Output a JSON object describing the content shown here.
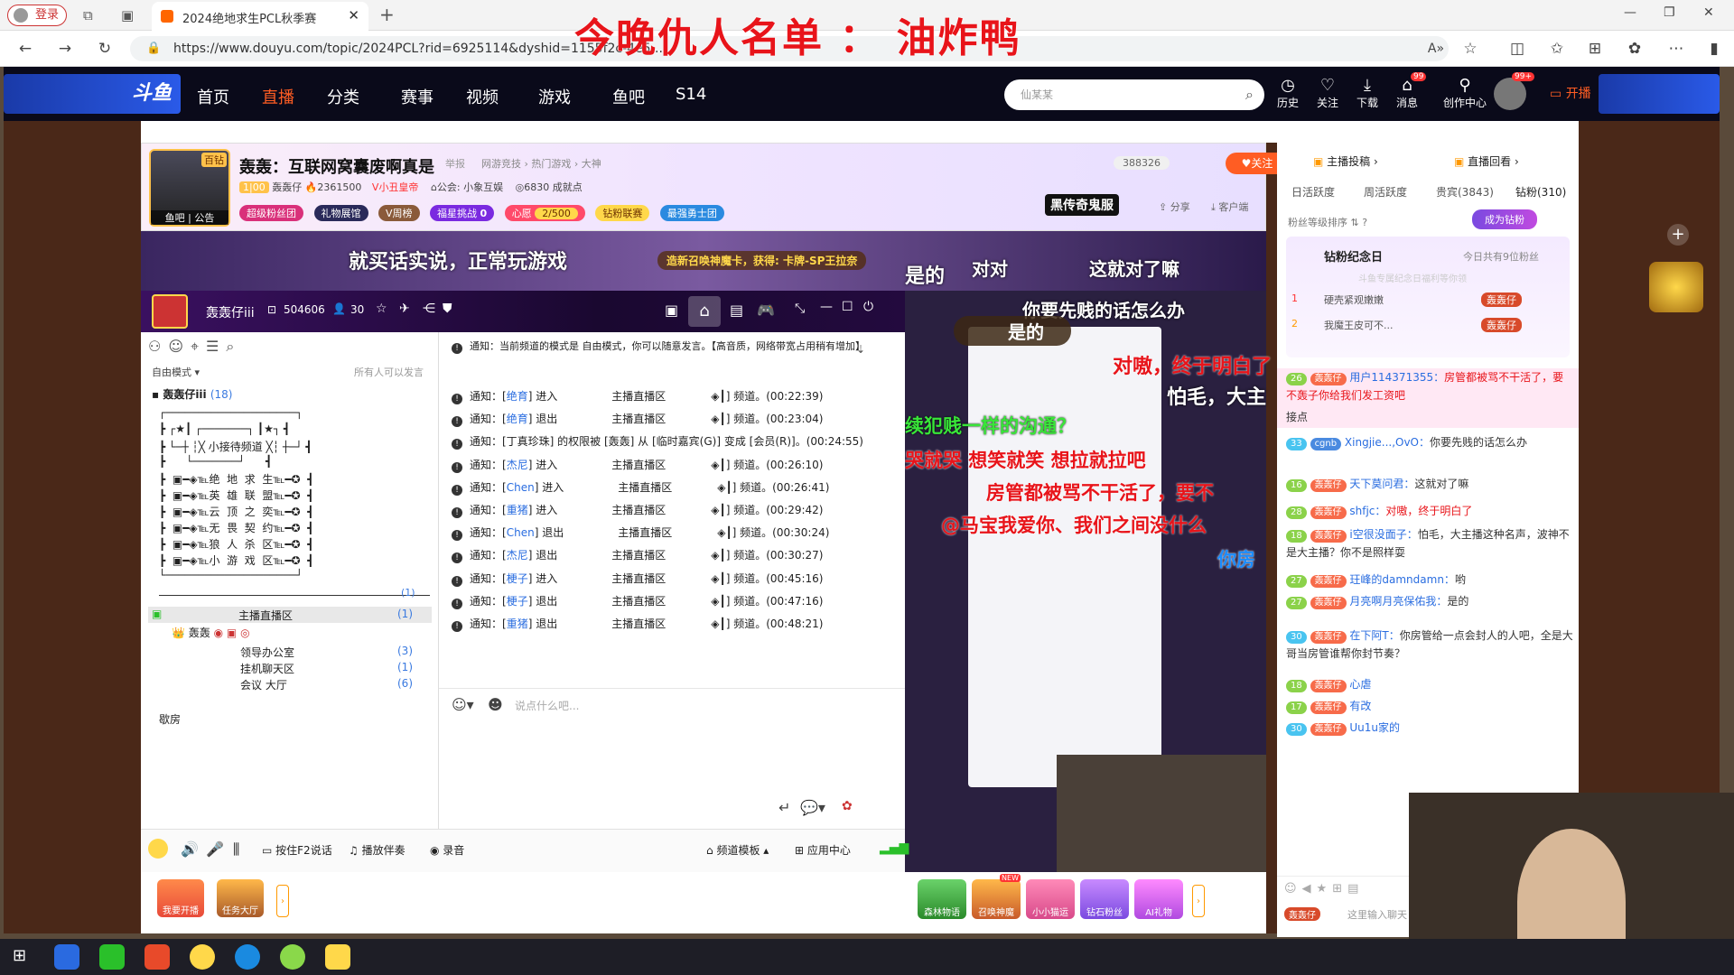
{
  "browser": {
    "login": "登录",
    "tab_title": "2024绝地求生PCL秋季赛",
    "url": "https://www.douyu.com/topic/2024PCL?rid=6925114&dyshid=1155f2c-4e5...",
    "overlay_title": "今晚仇人名单 ： 油炸鸭"
  },
  "nav": {
    "items": [
      "首页",
      "直播",
      "分类",
      "赛事",
      "视频",
      "游戏",
      "鱼吧",
      "S14"
    ],
    "search_placeholder": "仙某某",
    "icons": [
      {
        "label": "历史",
        "icon": "history-icon"
      },
      {
        "label": "关注",
        "icon": "heart-icon"
      },
      {
        "label": "下载",
        "icon": "download-icon"
      },
      {
        "label": "消息",
        "icon": "bell-icon"
      },
      {
        "label": "创作中心",
        "icon": "pin-icon"
      }
    ],
    "msg_badge": "99",
    "avatar_badge": "99+",
    "live_btn": "开播"
  },
  "room": {
    "title": "轰轰：互联网窝囊废啊真是",
    "report": "举报",
    "category": "网游竞技 › 热门游戏 › 大神",
    "streamer": "轰轰仔",
    "fans": "2361500",
    "tag": "小丑皇帝",
    "guild": "公会: 小象互娱",
    "achievements": "6830 成就点",
    "count": "388326",
    "follow": "关注",
    "share": "分享",
    "client": "客户端",
    "tags": [
      "超级粉丝团",
      "礼物展馆",
      "V周榜",
      "福星挑战",
      "心愿",
      "2/500",
      "钻粉联赛",
      "最强勇士团"
    ],
    "fuxing_val": "0",
    "avatar_caption": "鱼吧 | 公告",
    "badge": "百钻",
    "heichuan": "黑传奇鬼服"
  },
  "danmu_top": [
    "就买话实说，正常玩游戏",
    "造新召唤神魔卡，获得: 卡牌-SP王拉奈",
    "是的",
    "对对",
    "这就对了嘛"
  ],
  "yy": {
    "channel_name": "轰轰仔iii",
    "channel_id": "504606",
    "online": "30",
    "mode": "自由模式",
    "mode_right": "所有人可以发言",
    "tree_root": "轰轰仔iii",
    "tree_root_count": "(18)",
    "tree": [
      "┌────────────────────┐",
      "┣ ┌★┃ ┌───────┐ ┃★┐ ┫",
      "┣ └─┼ ┆╳ 小接待频道 ╳┆ ┼─┘ ┫",
      "┣      └───────┘      ┫",
      "┣  ▣━◈℡绝  地  求  生℡━✪  ┫",
      "┣  ▣━◈℡英  雄  联  盟℡━✪  ┫",
      "┣  ▣━◈℡云  顶  之  奕℡━✪  ┫",
      "┣  ▣━◈℡无  畏  契  约℡━✪  ┫",
      "┣  ▣━◈℡狼  人  杀  区℡━✪  ┫",
      "┣  ▣━◈℡小  游  戏  区℡━✪  ┫",
      "└────────────────────┘"
    ],
    "tree_sep_count": "(1)",
    "main_channel": "主播直播区",
    "main_count": "(1)",
    "main_user": "轰轰",
    "subs": [
      {
        "name": "领导办公室",
        "count": "(3)"
      },
      {
        "name": "挂机聊天区",
        "count": "(1)"
      },
      {
        "name": "会议  大厅",
        "count": "(6)"
      }
    ],
    "last_item": "歇房",
    "notice_head": "通知：当前频道的模式是 自由模式，你可以随意发言。【高音质，网络带宽占用稍有增加】",
    "notices": [
      {
        "user": "绝育",
        "act": "进入",
        "time": "(00:22:39)"
      },
      {
        "user": "绝育",
        "act": "退出",
        "time": "(00:23:04)"
      },
      {
        "user": "",
        "act": "perm",
        "time": "(00:24:55)"
      },
      {
        "user": "杰尼",
        "act": "进入",
        "time": "(00:26:10)"
      },
      {
        "user": "Chen",
        "act": "进入",
        "time": "(00:26:41)"
      },
      {
        "user": "重猪",
        "act": "进入",
        "time": "(00:29:42)"
      },
      {
        "user": "Chen",
        "act": "退出",
        "time": "(00:30:24)"
      },
      {
        "user": "杰尼",
        "act": "退出",
        "time": "(00:30:27)"
      },
      {
        "user": "梗子",
        "act": "进入",
        "time": "(00:45:16)"
      },
      {
        "user": "梗子",
        "act": "退出",
        "time": "(00:47:16)"
      },
      {
        "user": "重猪",
        "act": "退出",
        "time": "(00:48:21)"
      }
    ],
    "notice_prefix": "通知：",
    "notice_chan": "主播直播区",
    "notice_suffix": "◈┃] 频道。",
    "perm_text": "通知：[丁真珍珠] 的权限被 [轰轰] 从 [临时嘉宾(G)] 变成 [会员(R)]。",
    "input_placeholder": "说点什么吧...",
    "bottom": {
      "ptt": "按住F2说话",
      "music": "播放伴奏",
      "record": "录音",
      "template": "频道模板",
      "apps": "应用中心"
    }
  },
  "stream_overlays": [
    "你要先贱的话怎么办",
    "是的",
    "对嗷，终于明白了",
    "怕毛，大主",
    "续犯贱一样的沟通？",
    "哭就哭 想笑就笑 想拉就拉吧",
    "房管都被骂不干活了，要不",
    "@马宝我爱你、我们之间没什么",
    "你房"
  ],
  "right": {
    "top_tabs": [
      "主播投稿",
      "直播回看"
    ],
    "tabs": [
      "日活跃度",
      "周活跃度",
      "贵宾(3843)",
      "钻粉(310)"
    ],
    "sort": "粉丝等级排序",
    "become": "成为钻粉",
    "memorial": "钻粉纪念日",
    "memorial_info": "今日共有9位粉丝",
    "memorial_sub": "斗鱼专属纪念日福利等你领",
    "ranks": [
      {
        "n": "1",
        "name": "硬壳紧观嫩嫩"
      },
      {
        "n": "2",
        "name": "我魔王皮可不..."
      }
    ],
    "rank_badge": "轰轰仔",
    "messages": [
      {
        "lvl": "26",
        "user": "用户114371355：",
        "text": "房管都被骂不干活了，要不轰子你给我们发工资吧"
      },
      {
        "lvl": "",
        "user": "",
        "text": "接点"
      },
      {
        "lvl": "33",
        "fan": "cgnb",
        "user": "Xingjie...,OvO：",
        "text": "你要先贱的话怎么办"
      },
      {
        "lvl": "16",
        "user": "天下莫问君：",
        "text": "这就对了嘛"
      },
      {
        "lvl": "28",
        "user": "shfjc：",
        "text": "对嗷，终于明白了"
      },
      {
        "lvl": "18",
        "user": "i空很没面子：",
        "text": "怕毛，大主播这种名声，波神不是大主播？你不是照样耍"
      },
      {
        "lvl": "27",
        "user": "玨峰的damndamn：",
        "text": "哟"
      },
      {
        "lvl": "27",
        "user": "月亮啊月亮保佑我：",
        "text": "是的"
      },
      {
        "lvl": "30",
        "user": "在下阿T：",
        "text": "你房管给一点会封人的人吧，全是大哥当房管谁帮你封节奏？"
      },
      {
        "lvl": "18",
        "user": "心虐",
        "text": ""
      },
      {
        "lvl": "17",
        "user": "有改",
        "text": ""
      },
      {
        "lvl": "30",
        "user": "Uu1u家的",
        "text": ""
      }
    ],
    "fan_name": "轰轰仔",
    "input_placeholder": "这里输入聊天"
  },
  "bottom_bar": {
    "left": [
      "我要开播",
      "任务大厅"
    ],
    "right": [
      "森林物语",
      "召唤神魔",
      "小小猫运",
      "钻石粉丝",
      "AI礼物"
    ],
    "new": "NEW"
  },
  "colors": {
    "brand": "#ff5d23",
    "danmu_red": "#e8141a",
    "danmu_green": "#39e639",
    "danmu_blue": "#1a8cff",
    "dark_header": "#0a0a1a"
  }
}
